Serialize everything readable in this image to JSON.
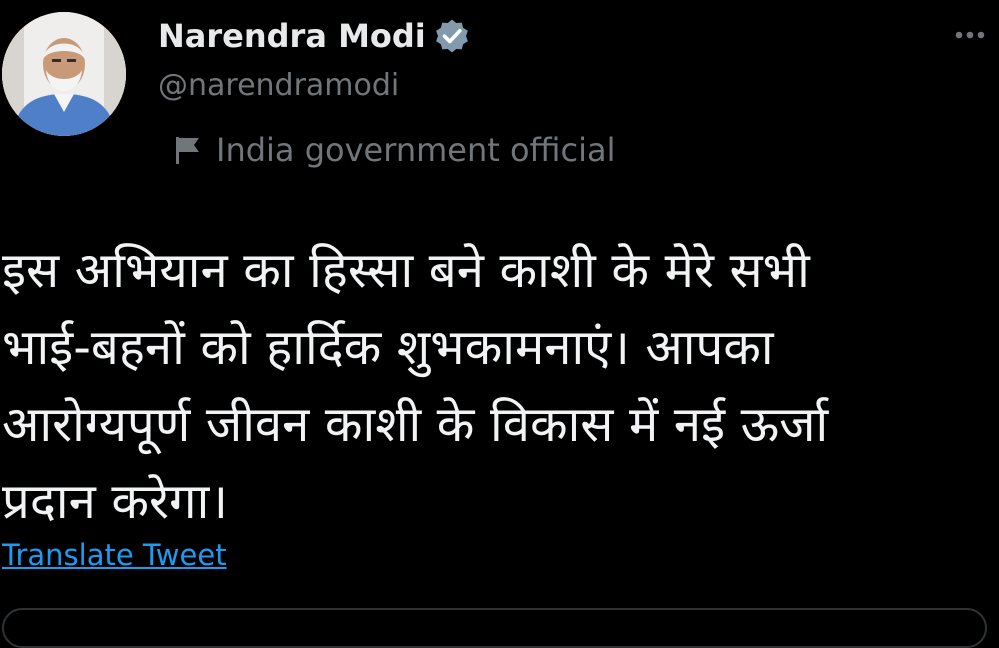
{
  "tweet": {
    "author": {
      "display_name": "Narendra Modi",
      "handle": "@narendramodi",
      "verified_icon": "verified-badge-icon",
      "affiliation": "India government official",
      "affiliation_icon": "flag-icon"
    },
    "more_icon": "more-options-icon",
    "text_lines": [
      "इस अभियान का हिस्सा बने काशी के मेरे सभी",
      "भाई-बहनों को हार्दिक शुभकामनाएं। आपका",
      "आरोग्यपूर्ण जीवन काशी के विकास में नई ऊर्जा",
      "प्रदान करेगा।"
    ],
    "translate_label": "Translate Tweet"
  },
  "colors": {
    "background": "#000000",
    "primary_text": "#e7e9ea",
    "secondary_text": "#71767b",
    "link": "#1d9bf0",
    "verified_badge": "#829aab"
  }
}
